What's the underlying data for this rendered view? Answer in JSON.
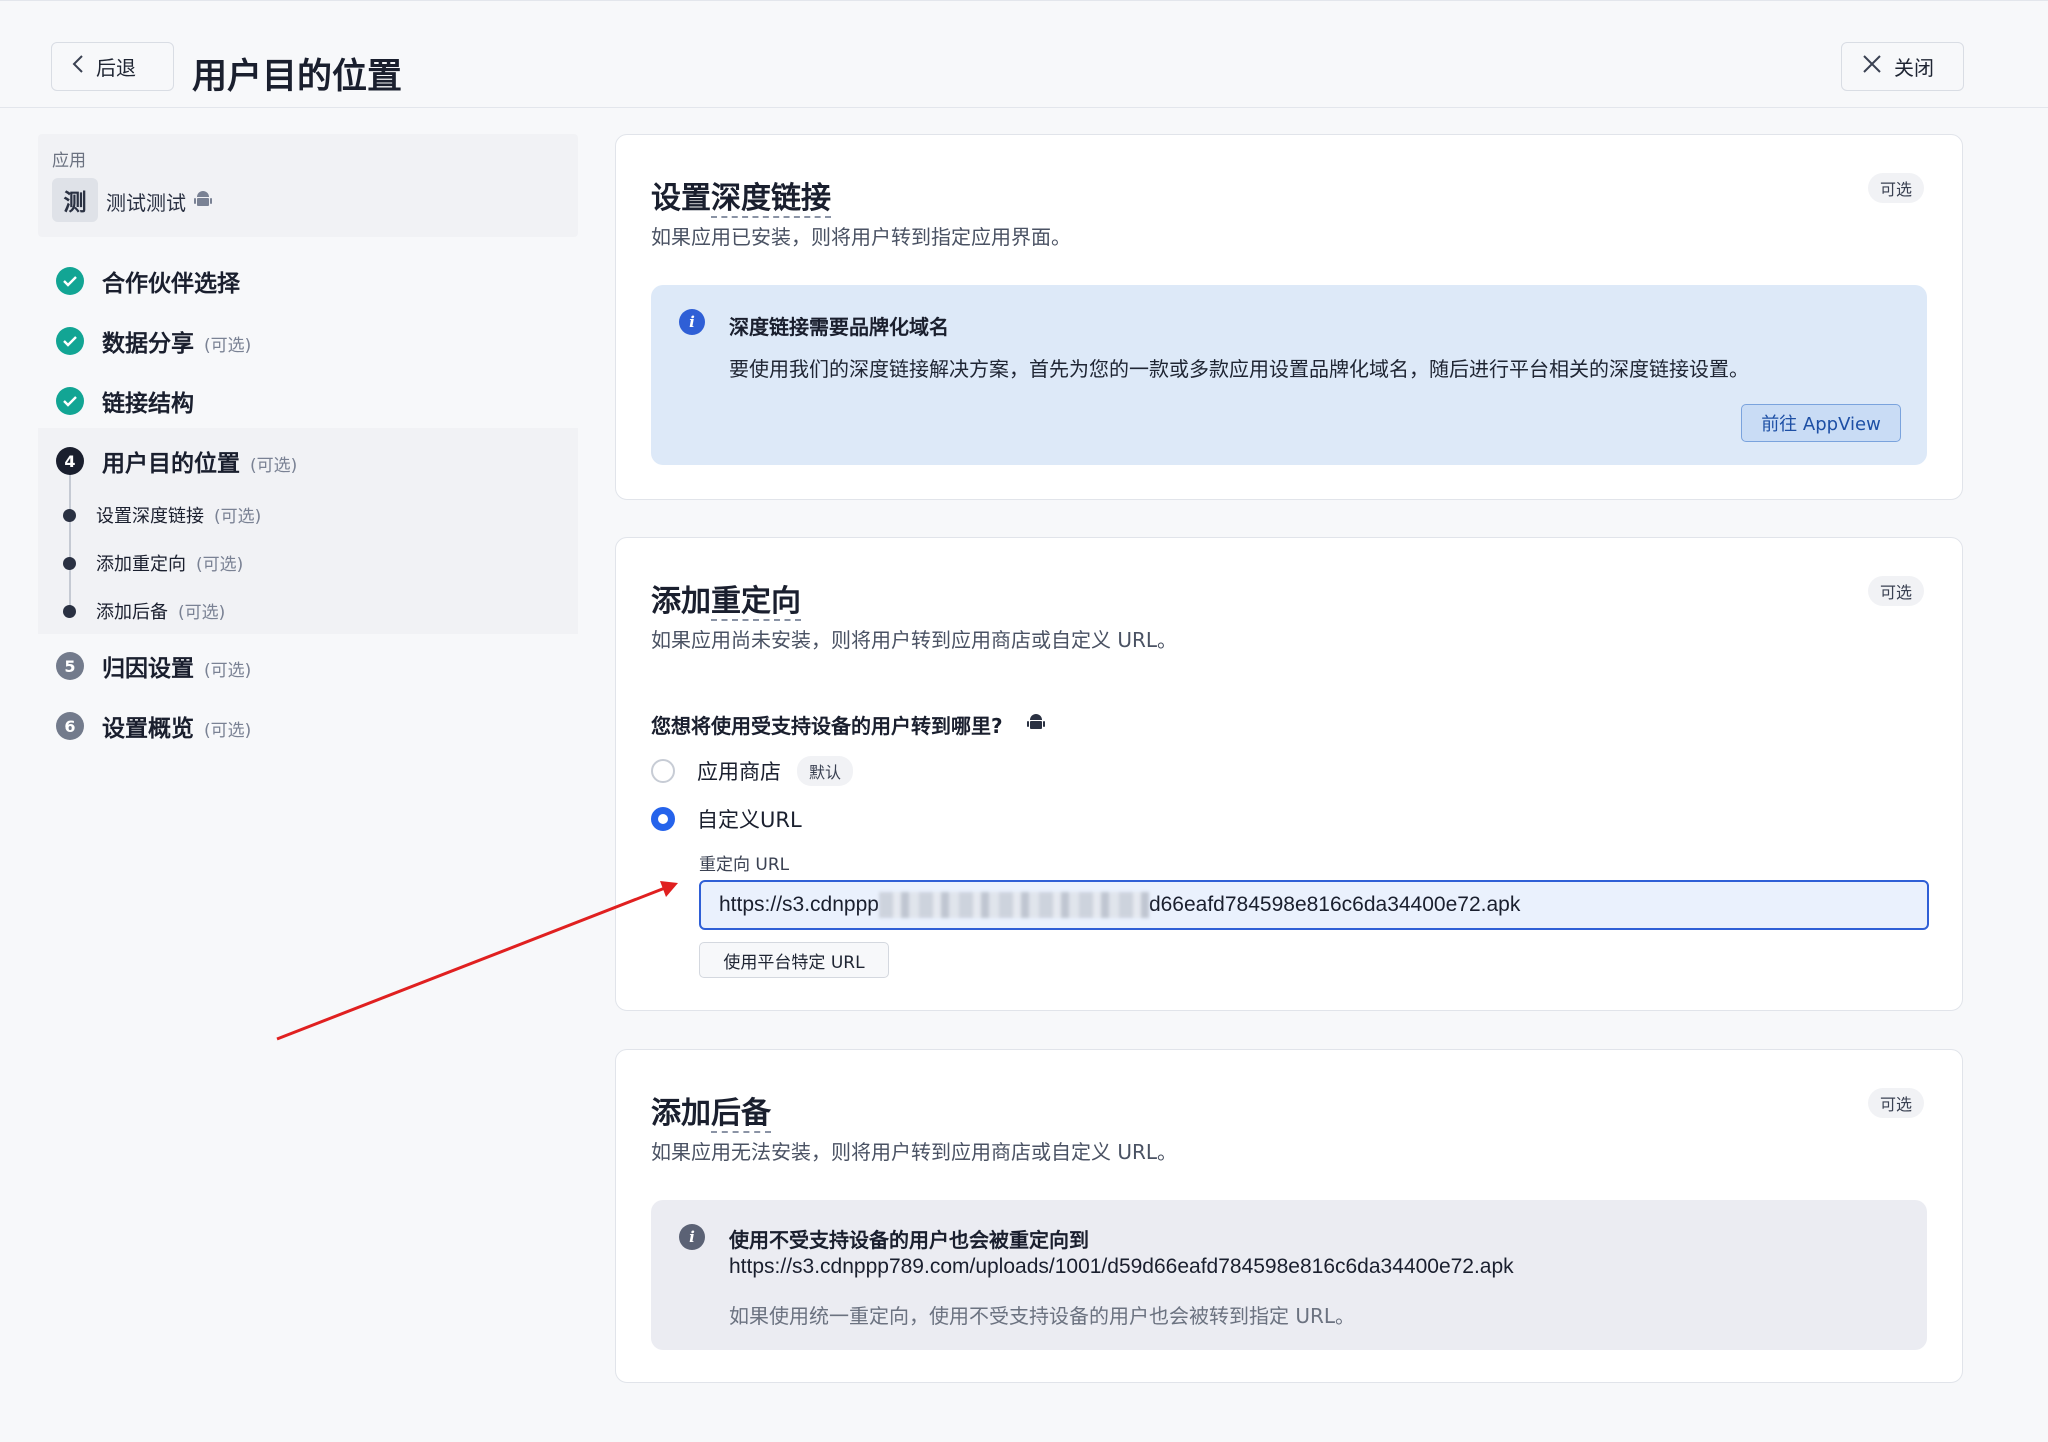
{
  "header": {
    "back_label": "后退",
    "title": "用户目的位置",
    "close_label": "关闭"
  },
  "sidebar": {
    "app_label": "应用",
    "app_avatar": "测",
    "app_name": "测试测试",
    "optional_text": "(可选)",
    "steps": [
      {
        "number": "1",
        "label": "合作伙伴选择",
        "status": "done"
      },
      {
        "number": "2",
        "label": "数据分享",
        "status": "done",
        "optional": "(可选)"
      },
      {
        "number": "3",
        "label": "链接结构",
        "status": "done"
      },
      {
        "number": "4",
        "label": "用户目的位置",
        "status": "active",
        "optional": "(可选)"
      },
      {
        "number": "5",
        "label": "归因设置",
        "status": "todo",
        "optional": "(可选)"
      },
      {
        "number": "6",
        "label": "设置概览",
        "status": "todo",
        "optional": "(可选)"
      }
    ],
    "substeps": [
      {
        "label": "设置深度链接",
        "optional": "(可选)"
      },
      {
        "label": "添加重定向",
        "optional": "(可选)"
      },
      {
        "label": "添加后备",
        "optional": "(可选)"
      }
    ]
  },
  "deep_link": {
    "title_prefix": "设置",
    "title_dashed": "深度链接",
    "subtitle": "如果应用已安装，则将用户转到指定应用界面。",
    "badge": "可选",
    "info_title": "深度链接需要品牌化域名",
    "info_body": "要使用我们的深度链接解决方案，首先为您的一款或多款应用设置品牌化域名，随后进行平台相关的深度链接设置。",
    "button": "前往 AppView"
  },
  "redirect": {
    "title_prefix": "添加",
    "title_dashed": "重定向",
    "subtitle": "如果应用尚未安装，则将用户转到应用商店或自定义 URL。",
    "badge": "可选",
    "question": "您想将使用受支持设备的用户转到哪里?",
    "option_store": "应用商店",
    "option_store_tag": "默认",
    "option_custom": "自定义URL",
    "selected": "自定义URL",
    "field_label": "重定向 URL",
    "url_start": "https://s3.cdnppp",
    "url_end": "d66eafd784598e816c6da34400e72.apk",
    "platform_button": "使用平台特定 URL"
  },
  "fallback": {
    "title_prefix": "添加",
    "title_dashed": "后备",
    "subtitle": "如果应用无法安装，则将用户转到应用商店或自定义 URL。",
    "badge": "可选",
    "info_title": "使用不受支持设备的用户也会被重定向到",
    "info_url": "https://s3.cdnppp789.com/uploads/1001/d59d66eafd784598e816c6da34400e72.apk",
    "info_note": "如果使用统一重定向，使用不受支持设备的用户也会被转到指定 URL。"
  },
  "colors": {
    "done": "#12a594",
    "active": "#1a1f2e",
    "todo": "#737b8c",
    "accent_blue": "#2563eb",
    "annotation_arrow": "#e02020"
  },
  "icons": {
    "back": "chevron-left-icon",
    "close": "close-x-icon",
    "android": "android-icon",
    "info": "info-icon",
    "check": "check-icon"
  }
}
